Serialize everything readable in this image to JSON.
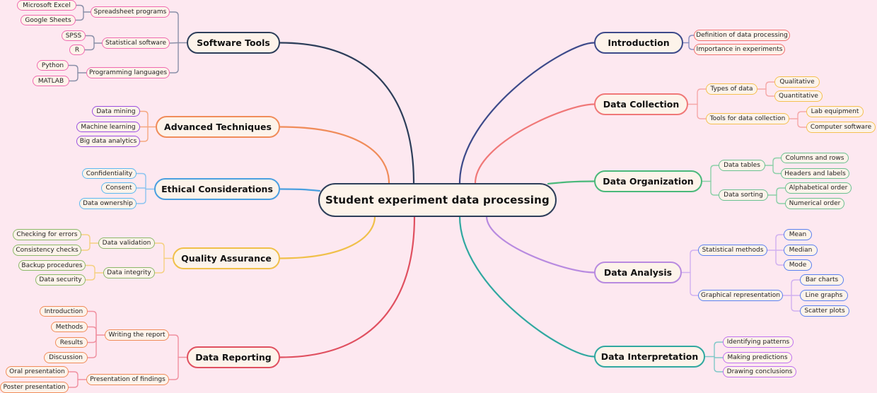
{
  "title": "Student experiment data processing",
  "colors": {
    "background": "#fde8f0",
    "node_fill": "#fdf3ea",
    "center_border": "#2d3e5a"
  },
  "branches": [
    {
      "id": "software-tools",
      "label": "Software Tools",
      "side": "left",
      "color": "#2d3e5a",
      "line_color": "#8a8fa8",
      "leaf_color": "#f06ab0",
      "children": [
        {
          "label": "Spreadsheet programs",
          "children": [
            {
              "label": "Microsoft Excel"
            },
            {
              "label": "Google Sheets"
            }
          ]
        },
        {
          "label": "Statistical software",
          "children": [
            {
              "label": "SPSS"
            },
            {
              "label": "R"
            }
          ]
        },
        {
          "label": "Programming languages",
          "children": [
            {
              "label": "Python"
            },
            {
              "label": "MATLAB"
            }
          ]
        }
      ]
    },
    {
      "id": "advanced-techniques",
      "label": "Advanced Techniques",
      "side": "left",
      "color": "#f08c5a",
      "line_color": "#f5a880",
      "leaf_color": "#9b4fe0",
      "children": [
        {
          "label": "Data mining"
        },
        {
          "label": "Machine learning"
        },
        {
          "label": "Big data analytics"
        }
      ]
    },
    {
      "id": "ethical-considerations",
      "label": "Ethical Considerations",
      "side": "left",
      "color": "#4a9fe0",
      "line_color": "#8cc4f0",
      "leaf_color": "#5ab8f0",
      "children": [
        {
          "label": "Confidentiality"
        },
        {
          "label": "Consent"
        },
        {
          "label": "Data ownership"
        }
      ]
    },
    {
      "id": "quality-assurance",
      "label": "Quality Assurance",
      "side": "left",
      "color": "#f0c04a",
      "line_color": "#f5d080",
      "leaf_color": "#8cb86a",
      "children": [
        {
          "label": "Data validation",
          "children": [
            {
              "label": "Checking for errors"
            },
            {
              "label": "Consistency checks"
            }
          ]
        },
        {
          "label": "Data integrity",
          "children": [
            {
              "label": "Backup procedures"
            },
            {
              "label": "Data security"
            }
          ]
        }
      ]
    },
    {
      "id": "data-reporting",
      "label": "Data Reporting",
      "side": "left",
      "color": "#e05060",
      "line_color": "#f090a0",
      "leaf_color": "#f08c5a",
      "children": [
        {
          "label": "Writing the report",
          "children": [
            {
              "label": "Introduction"
            },
            {
              "label": "Methods"
            },
            {
              "label": "Results"
            },
            {
              "label": "Discussion"
            }
          ]
        },
        {
          "label": "Presentation of findings",
          "children": [
            {
              "label": "Oral presentation"
            },
            {
              "label": "Poster presentation"
            }
          ]
        }
      ]
    },
    {
      "id": "introduction",
      "label": "Introduction",
      "side": "right",
      "color": "#3d4a8a",
      "line_color": "#8a8fc0",
      "leaf_color": "#f07070",
      "children": [
        {
          "label": "Definition of data processing"
        },
        {
          "label": "Importance in experiments"
        }
      ]
    },
    {
      "id": "data-collection",
      "label": "Data Collection",
      "side": "right",
      "color": "#f07878",
      "line_color": "#f5a8a8",
      "leaf_color": "#f5c050",
      "children": [
        {
          "label": "Types of data",
          "children": [
            {
              "label": "Qualitative"
            },
            {
              "label": "Quantitative"
            }
          ]
        },
        {
          "label": "Tools for data collection",
          "children": [
            {
              "label": "Lab equipment"
            },
            {
              "label": "Computer software"
            }
          ]
        }
      ]
    },
    {
      "id": "data-organization",
      "label": "Data Organization",
      "side": "right",
      "color": "#4ab87a",
      "line_color": "#8cd0a8",
      "leaf_color": "#6ac090",
      "children": [
        {
          "label": "Data tables",
          "children": [
            {
              "label": "Columns and rows"
            },
            {
              "label": "Headers and labels"
            }
          ]
        },
        {
          "label": "Data sorting",
          "children": [
            {
              "label": "Alphabetical order"
            },
            {
              "label": "Numerical order"
            }
          ]
        }
      ]
    },
    {
      "id": "data-analysis",
      "label": "Data Analysis",
      "side": "right",
      "color": "#b88ae0",
      "line_color": "#d0b0f0",
      "leaf_color": "#5a80f0",
      "children": [
        {
          "label": "Statistical methods",
          "children": [
            {
              "label": "Mean"
            },
            {
              "label": "Median"
            },
            {
              "label": "Mode"
            }
          ]
        },
        {
          "label": "Graphical representation",
          "children": [
            {
              "label": "Bar charts"
            },
            {
              "label": "Line graphs"
            },
            {
              "label": "Scatter plots"
            }
          ]
        }
      ]
    },
    {
      "id": "data-interpretation",
      "label": "Data Interpretation",
      "side": "right",
      "color": "#30a8a0",
      "line_color": "#80c8c8",
      "leaf_color": "#c070f0",
      "children": [
        {
          "label": "Identifying patterns"
        },
        {
          "label": "Making predictions"
        },
        {
          "label": "Drawing conclusions"
        }
      ]
    }
  ]
}
